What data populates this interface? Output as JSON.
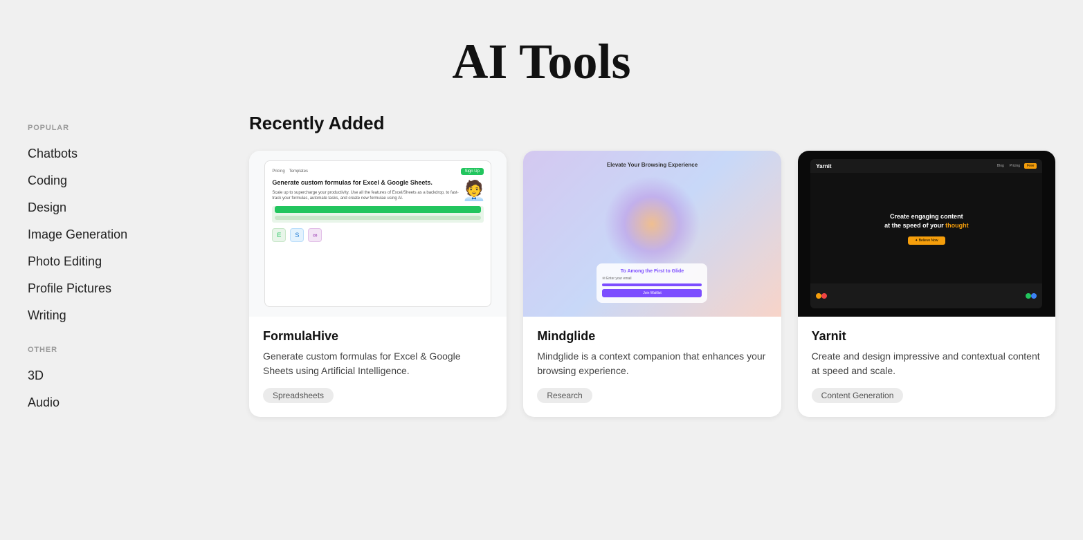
{
  "header": {
    "title": "AI Tools"
  },
  "sidebar": {
    "popular_label": "POPULAR",
    "popular_items": [
      {
        "label": "Chatbots",
        "id": "chatbots"
      },
      {
        "label": "Coding",
        "id": "coding"
      },
      {
        "label": "Design",
        "id": "design"
      },
      {
        "label": "Image Generation",
        "id": "image-generation"
      },
      {
        "label": "Photo Editing",
        "id": "photo-editing"
      },
      {
        "label": "Profile Pictures",
        "id": "profile-pictures"
      },
      {
        "label": "Writing",
        "id": "writing"
      }
    ],
    "other_label": "OTHER",
    "other_items": [
      {
        "label": "3D",
        "id": "3d"
      },
      {
        "label": "Audio",
        "id": "audio"
      }
    ]
  },
  "main": {
    "section_title": "Recently Added",
    "cards": [
      {
        "id": "formulahive",
        "name": "FormulaHive",
        "description": "Generate custom formulas for Excel & Google Sheets using Artificial Intelligence.",
        "tag": "Spreadsheets"
      },
      {
        "id": "mindglide",
        "name": "Mindglide",
        "description": "Mindglide is a context companion that enhances your browsing experience.",
        "tag": "Research"
      },
      {
        "id": "yarnit",
        "name": "Yarnit",
        "description": "Create and design impressive and contextual content at speed and scale.",
        "tag": "Content Generation"
      }
    ]
  },
  "colors": {
    "background": "#f0f0f0",
    "card_bg": "#ffffff",
    "accent_green": "#22c55e",
    "accent_purple": "#7c4dff",
    "accent_amber": "#f59e0b",
    "tag_bg": "#ebebeb"
  }
}
